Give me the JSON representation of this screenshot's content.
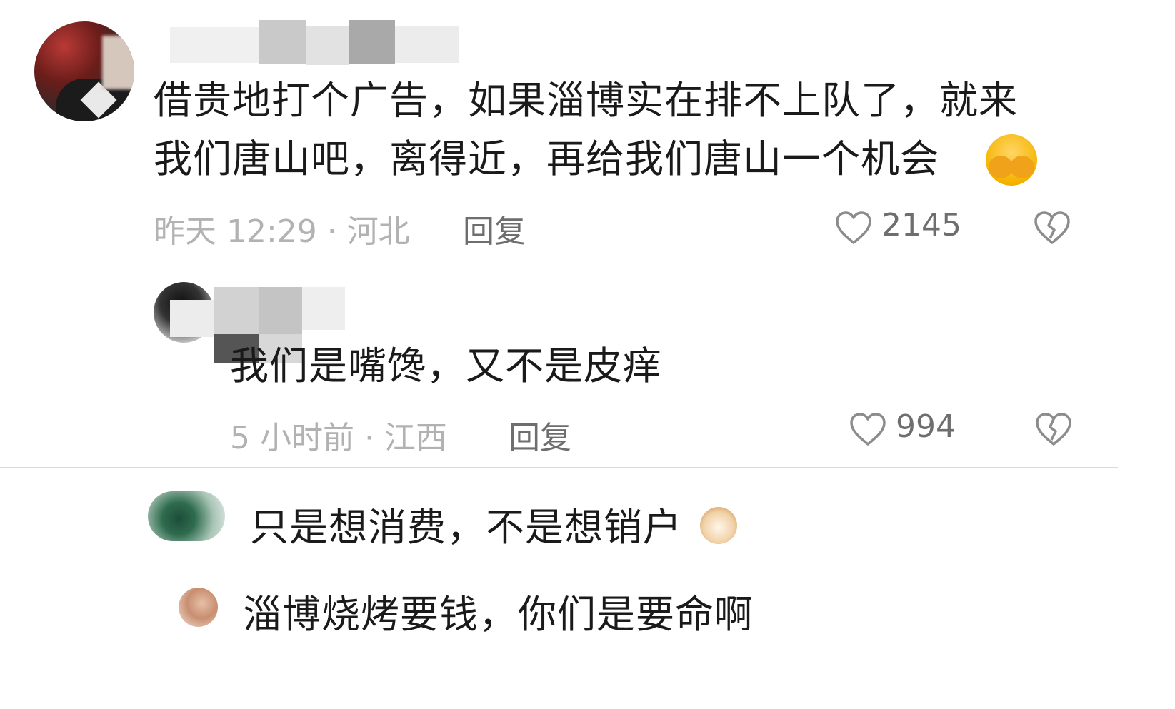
{
  "comments": [
    {
      "text_line1": "借贵地打个广告，如果淄博实在排不上队了，就来",
      "text_line2": "我们唐山吧，离得近，再给我们唐山一个机会",
      "meta": "昨天 12:29 · 河北",
      "reply_label": "回复",
      "likes": "2145",
      "emoji_icon": "covering-face-emoji-icon"
    },
    {
      "text": "我们是嘴馋，又不是皮痒",
      "meta": "5 小时前 · 江西",
      "reply_label": "回复",
      "likes": "994"
    },
    {
      "text": "只是想消费，不是想销户",
      "emoji_icon": "cat-emoji-icon"
    },
    {
      "text": "淄博烧烤要钱，你们是要命啊"
    }
  ],
  "icons": {
    "like": "heart-outline-icon",
    "dislike": "broken-heart-icon"
  },
  "colors": {
    "meta_text": "#b2b2b2",
    "reply_text": "#6e6e6e",
    "body_text": "#1a1a1a",
    "divider": "#d9d9d9"
  }
}
